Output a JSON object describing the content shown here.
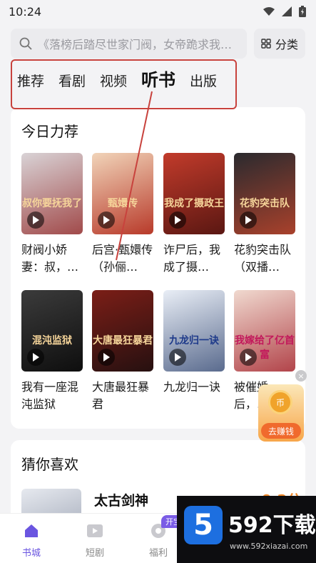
{
  "status": {
    "time": "10:24"
  },
  "search": {
    "placeholder": "《落榜后踏尽世家门阀，女帝跪求我…",
    "category_label": "分类"
  },
  "tabs": [
    {
      "label": "推荐"
    },
    {
      "label": "看剧"
    },
    {
      "label": "视频"
    },
    {
      "label": "听书"
    },
    {
      "label": "出版"
    }
  ],
  "section_today": {
    "title": "今日力荐",
    "books": [
      {
        "title": "财阀小娇妻：叔，…",
        "cover_text": "叔你要抚我了",
        "color1": "#d9d3d6",
        "color2": "#a14a4a"
      },
      {
        "title": "后宫·甄嬛传（孙俪…",
        "cover_text": "甄嬛传",
        "color1": "#f1d4b9",
        "color2": "#b83a2a"
      },
      {
        "title": "诈尸后，我成了摄…",
        "cover_text": "我成了摄政王",
        "color1": "#c23b2b",
        "color2": "#5a1712"
      },
      {
        "title": "花豹突击队（双播…",
        "cover_text": "花豹突击队",
        "color1": "#2a2a2e",
        "color2": "#a9412c"
      },
      {
        "title": "我有一座混沌监狱",
        "cover_text": "混沌监狱",
        "color1": "#3b3b3b",
        "color2": "#0e0e0e"
      },
      {
        "title": "大唐最狂暴君",
        "cover_text": "大唐最狂暴君",
        "color1": "#7b1e17",
        "color2": "#261010"
      },
      {
        "title": "九龙归一诀",
        "cover_text": "九龙归一诀",
        "color1": "#e9eef6",
        "color2": "#5a6b8e"
      },
      {
        "title": "被催婚后，…",
        "cover_text": "我嫁给了亿首富",
        "color1": "#f0d9cf",
        "color2": "#b2444a"
      }
    ]
  },
  "promo": {
    "label": "去赚钱",
    "coin": "币"
  },
  "section_guess": {
    "title": "猜你喜欢",
    "item_title": "太古剑神",
    "item_score": "9.2分"
  },
  "bottom_nav": [
    {
      "label": "书城"
    },
    {
      "label": "短剧"
    },
    {
      "label": "福利"
    }
  ],
  "nav_badge": "开宝",
  "watermark": {
    "text": "592下载",
    "badge": "5",
    "url": "www.592xiazai.com"
  },
  "colors": {
    "accent": "#6a55e0",
    "annotation": "#c8423d",
    "score": "#f08a2c"
  }
}
